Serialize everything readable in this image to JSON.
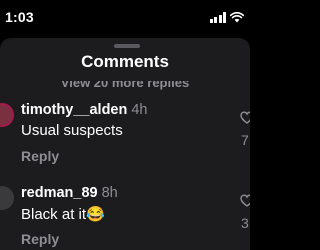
{
  "status_bar": {
    "time": "1:03"
  },
  "sheet": {
    "title": "Comments",
    "view_more_replies": "View 20 more replies"
  },
  "comments": [
    {
      "username": "timothy__alden",
      "time_ago": "4h",
      "text": "Usual suspects",
      "reply_label": "Reply",
      "like_count": "7"
    },
    {
      "username": "redman_89",
      "time_ago": "8h",
      "text": "Black at it😂",
      "reply_label": "Reply",
      "like_count": "3"
    }
  ],
  "colors": {
    "background": "#000000",
    "sheet": "#1c1c1e",
    "secondary_text": "#8e8e93",
    "avatar_ring": "#a7194b"
  },
  "icons": [
    "signal-bars-icon",
    "wifi-icon",
    "heart-icon"
  ]
}
